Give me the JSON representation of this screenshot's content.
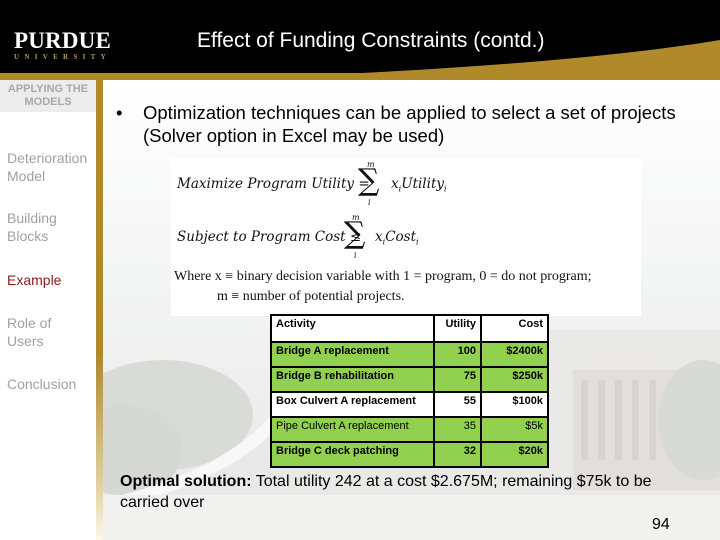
{
  "header": {
    "logo_name": "PURDUE",
    "logo_subtitle": "UNIVERSITY",
    "title": "Effect of Funding Constraints (contd.)"
  },
  "sidebar": {
    "section_title": "APPLYING THE MODELS",
    "items": [
      {
        "label": "Deterioration Model",
        "active": false
      },
      {
        "label": "Building Blocks",
        "active": false
      },
      {
        "label": "Example",
        "active": true
      },
      {
        "label": "Role of Users",
        "active": false
      },
      {
        "label": "Conclusion",
        "active": false
      }
    ]
  },
  "content": {
    "bullet_symbol": "•",
    "bullet_text": "Optimization techniques can be applied to select a set of projects (Solver option in Excel may be used)",
    "formula": {
      "objective_lhs": "Maximize Program Utility =",
      "objective_term": "x",
      "objective_term_rest": "Utility",
      "constraint_lhs": "Subject to Program Cost ≤",
      "constraint_term": "x",
      "constraint_term_rest": "Cost",
      "index": "i",
      "upper": "m",
      "sigma": "∑",
      "where_line1": "Where x ≡ binary decision variable with 1 = program, 0 = do not program;",
      "where_line2": "m ≡ number of potential projects."
    },
    "table": {
      "columns": [
        "Activity",
        "Utility",
        "Cost"
      ],
      "rows": [
        {
          "activity": "Bridge A replacement",
          "utility": "100",
          "cost": "$2400k",
          "selected": true,
          "bold": true
        },
        {
          "activity": "Bridge B rehabilitation",
          "utility": "75",
          "cost": "$250k",
          "selected": true,
          "bold": true
        },
        {
          "activity": "Box Culvert A replacement",
          "utility": "55",
          "cost": "$100k",
          "selected": false,
          "bold": true
        },
        {
          "activity": "Pipe Culvert A replacement",
          "utility": "35",
          "cost": "$5k",
          "selected": true,
          "bold": false
        },
        {
          "activity": "Bridge C deck patching",
          "utility": "32",
          "cost": "$20k",
          "selected": true,
          "bold": true
        }
      ]
    },
    "solution_label": "Optimal solution:",
    "solution_text": " Total utility 242 at a cost $2.675M; remaining $75k to be carried over",
    "page_number": "94"
  },
  "colors": {
    "header_bg": "#000000",
    "gold": "#b08a2a",
    "selected_row": "#92d050",
    "active_nav": "#8b1a1a",
    "inactive_nav": "#a0a0a0"
  }
}
